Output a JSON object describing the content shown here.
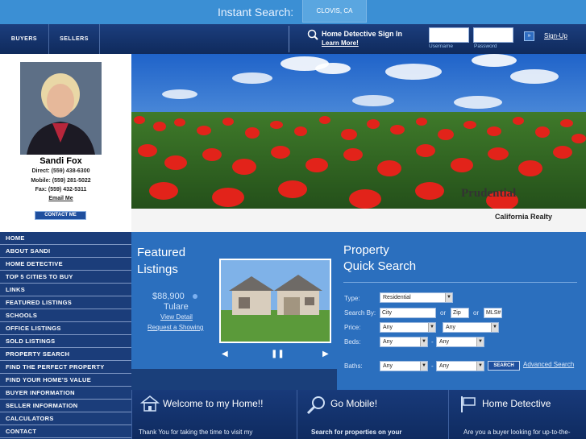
{
  "topbar": {
    "label": "Instant Search:",
    "location": "CLOVIS, CA"
  },
  "nav": {
    "buyers": "BUYERS",
    "sellers": "SELLERS"
  },
  "login": {
    "title": "Home Detective Sign In",
    "learn_more": "Learn More!",
    "username_label": "Username",
    "password_label": "Password",
    "go": "»",
    "signup": "Sign-Up"
  },
  "agent": {
    "name": "Sandi Fox",
    "direct": "Direct: (559) 438-6300",
    "mobile": "Mobile: (559) 281-5022",
    "fax": "Fax: (559) 432-5311",
    "email": "Email Me",
    "contact": "CONTACT ME"
  },
  "hero": {
    "brand": "Prudential",
    "realty": "California Realty"
  },
  "menu": [
    "HOME",
    "ABOUT SANDI",
    "HOME DETECTIVE",
    "TOP 5 CITIES TO BUY",
    "LINKS",
    "FEATURED LISTINGS",
    "SCHOOLS",
    "OFFICE LISTINGS",
    "SOLD LISTINGS",
    "PROPERTY SEARCH",
    "FIND THE PERFECT PROPERTY",
    "FIND YOUR HOME'S VALUE",
    "BUYER INFORMATION",
    "SELLER INFORMATION",
    "CALCULATORS",
    "CONTACT"
  ],
  "featured": {
    "title_line1": "Featured",
    "title_line2": "Listings",
    "price": "$88,900",
    "city": "Tulare",
    "view": "View Detail",
    "request": "Request a Showing"
  },
  "quick_search": {
    "title_line1": "Property",
    "title_line2": "Quick Search",
    "type_label": "Type:",
    "type_value": "Residential",
    "search_by_label": "Search By:",
    "city_value": "City",
    "or1": "or",
    "zip_value": "Zip",
    "or2": "or",
    "mls_value": "MLS#",
    "price_label": "Price:",
    "beds_label": "Beds:",
    "baths_label": "Baths:",
    "any": "Any",
    "dash": "-",
    "search_button": "SEARCH",
    "advanced": "Advanced Search"
  },
  "panels": {
    "welcome_title": "Welcome to my Home!!",
    "welcome_text": "Thank You for taking the time to visit my",
    "mobile_title": "Go Mobile!",
    "mobile_text": "Search for properties on your",
    "detective_title": "Home Detective",
    "detective_text": "Are you a buyer looking for up-to-the-"
  }
}
